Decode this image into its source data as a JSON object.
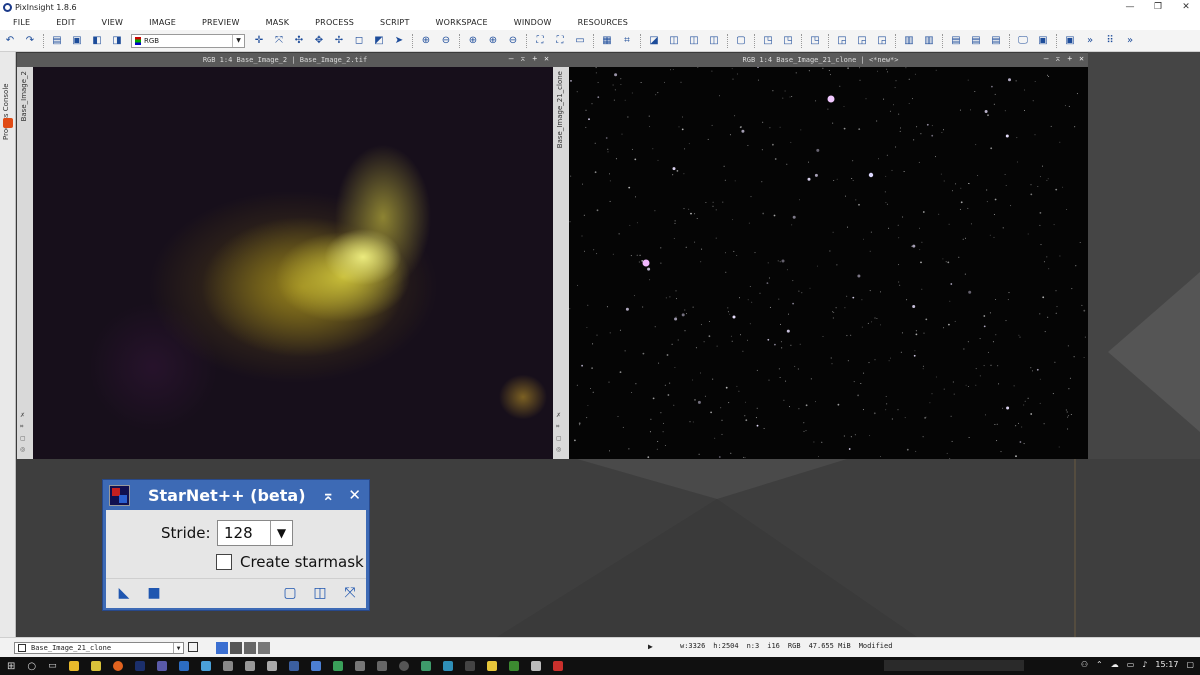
{
  "app": {
    "title": "PixInsight 1.8.6"
  },
  "menu": [
    "FILE",
    "EDIT",
    "VIEW",
    "IMAGE",
    "PREVIEW",
    "MASK",
    "PROCESS",
    "SCRIPT",
    "WORKSPACE",
    "WINDOW",
    "RESOURCES"
  ],
  "toolbar": {
    "channel_select": "RGB"
  },
  "left_dock": {
    "process_console_tab": "Process Console"
  },
  "windows": [
    {
      "title": "RGB 1:4 Base_Image_2 | Base_Image_2.tif",
      "side_label": "Base_Image_2"
    },
    {
      "title": "RGB 1:4 Base_Image_21_clone | <*new*>",
      "side_label": "Base_Image_21_clone"
    }
  ],
  "dialog": {
    "title": "StarNet++ (beta)",
    "stride_label": "Stride:",
    "stride_value": "128",
    "starmask_label": "Create starmask",
    "starmask_checked": false
  },
  "statusbar": {
    "view_select": "Base_Image_21_clone",
    "width": "w:3326",
    "height": "h:2504",
    "channels": "n:3",
    "depth": "i16",
    "colorspace": "RGB",
    "size": "47.655 MiB",
    "state": "Modified"
  },
  "taskbar": {
    "time": "15:17"
  },
  "colors": {
    "dialog_accent": "#3d6ab5",
    "toolbar_icon": "#1d4c9a"
  }
}
